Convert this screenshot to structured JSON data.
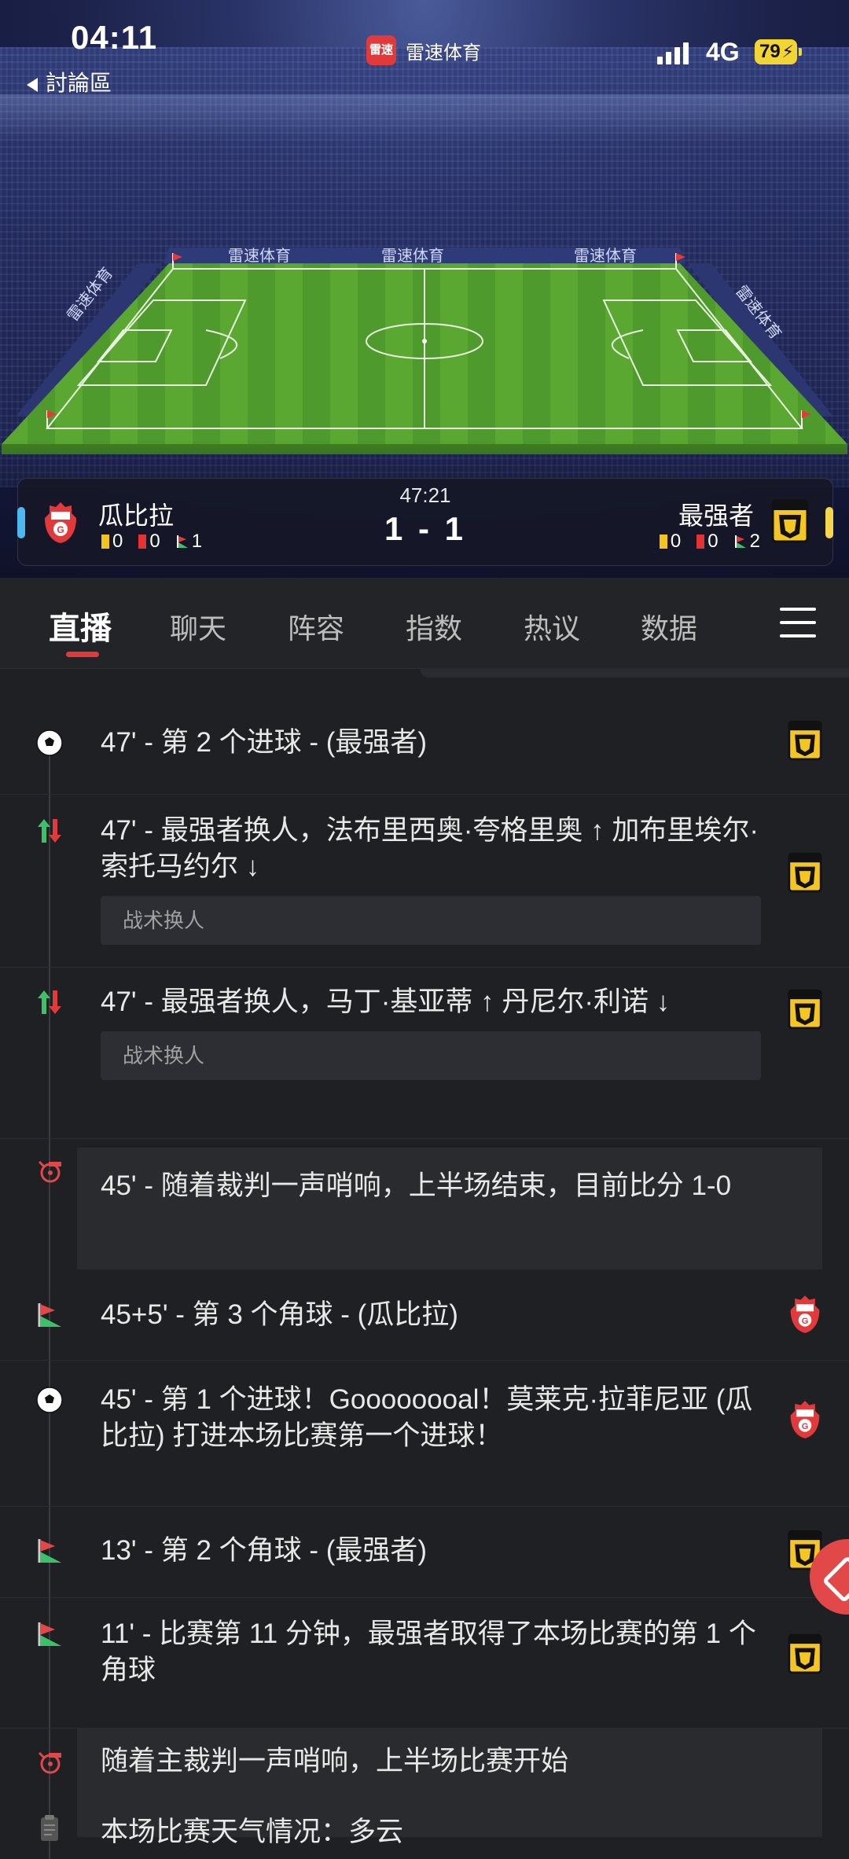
{
  "status_bar": {
    "time": "04:11",
    "back_label": "討論區",
    "app_name": "雷速体育",
    "app_logo_text": "雷速",
    "network": "4G",
    "battery": "79"
  },
  "match": {
    "minute": "47:21",
    "score": "1 - 1",
    "home": {
      "name": "瓜比拉",
      "yellow": "0",
      "red": "0",
      "corners": "1"
    },
    "away": {
      "name": "最强者",
      "yellow": "0",
      "red": "0",
      "corners": "2"
    }
  },
  "field_banner": [
    "雷速体育",
    "雷速体育",
    "雷速体育"
  ],
  "field_side_banners": [
    "雷速体育",
    "雷速体育"
  ],
  "tabs": [
    "直播",
    "聊天",
    "阵容",
    "指数",
    "热议",
    "数据"
  ],
  "active_tab": "直播",
  "events": [
    {
      "icon": "football-icon",
      "team": "away",
      "text": "47' - 第 2 个进球 - (最强者)"
    },
    {
      "icon": "substitution-icon",
      "team": "away",
      "text": "47' - 最强者换人，法布里西奥·夸格里奥 ↑ 加布里埃尔·索托马约尔 ↓",
      "note": "战术换人"
    },
    {
      "icon": "substitution-icon",
      "team": "away",
      "text": "47' - 最强者换人，马丁·基亚蒂 ↑ 丹尼尔·利诺 ↓",
      "note": "战术换人"
    },
    {
      "icon": "whistle-icon",
      "team": "",
      "text": "45' - 随着裁判一声哨响，上半场结束，目前比分 1-0"
    },
    {
      "icon": "corner-flag-icon",
      "team": "home",
      "text": "45+5' - 第 3 个角球 - (瓜比拉)"
    },
    {
      "icon": "football-icon",
      "team": "home",
      "text": "45' - 第 1 个进球！Goooooooal！莫莱克·拉菲尼亚 (瓜比拉) 打进本场比赛第一个进球！"
    },
    {
      "icon": "corner-flag-icon",
      "team": "away",
      "text": "13' - 第 2 个角球 - (最强者)"
    },
    {
      "icon": "corner-flag-icon",
      "team": "away",
      "text": "11' - 比赛第 11 分钟，最强者取得了本场比赛的第 1 个角球"
    },
    {
      "icon": "whistle-icon",
      "team": "",
      "text": "随着主裁判一声哨响，上半场比赛开始"
    },
    {
      "icon": "clipboard-icon",
      "team": "",
      "text": "本场比赛天气情况：多云"
    }
  ],
  "colors": {
    "accent": "#e03a3a",
    "home_bar": "#4fb7f0",
    "away_bar": "#f5d54b",
    "pitch": "#5aa832"
  }
}
